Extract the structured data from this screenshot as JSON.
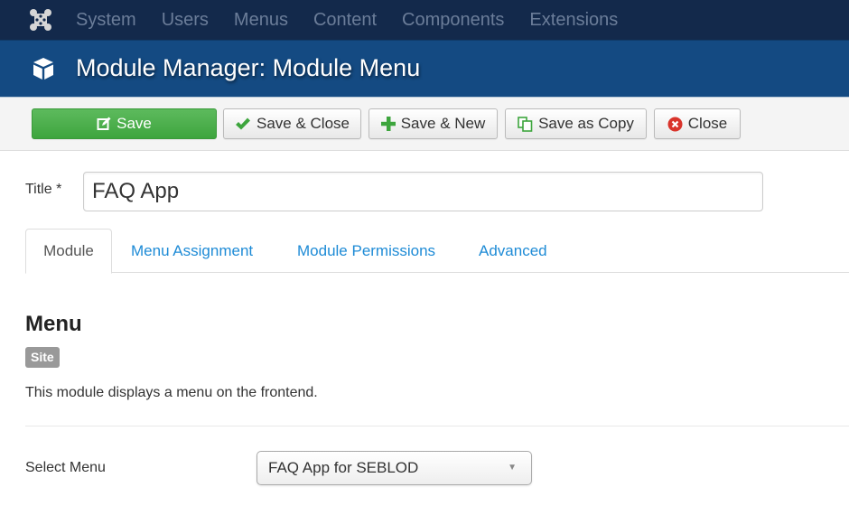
{
  "navbar": {
    "logo_icon": "joomla-logo-icon",
    "items": [
      "System",
      "Users",
      "Menus",
      "Content",
      "Components",
      "Extensions"
    ]
  },
  "header": {
    "icon": "cube-icon",
    "title": "Module Manager: Module Menu"
  },
  "toolbar": {
    "buttons": [
      {
        "label": "Save",
        "icon": "edit-icon",
        "style": "success"
      },
      {
        "label": "Save & Close",
        "icon": "check-icon"
      },
      {
        "label": "Save & New",
        "icon": "plus-icon"
      },
      {
        "label": "Save as Copy",
        "icon": "copy-icon"
      },
      {
        "label": "Close",
        "icon": "cancel-circle-icon"
      }
    ]
  },
  "form": {
    "title_label": "Title *",
    "title_value": "FAQ App"
  },
  "tabs": [
    {
      "label": "Module",
      "active": true
    },
    {
      "label": "Menu Assignment",
      "active": false
    },
    {
      "label": "Module Permissions",
      "active": false
    },
    {
      "label": "Advanced",
      "active": false
    }
  ],
  "content": {
    "section_title": "Menu",
    "badge": "Site",
    "description": "This module displays a menu on the frontend.",
    "select_menu_label": "Select Menu",
    "select_menu_value": "FAQ App for SEBLOD"
  },
  "colors": {
    "navbar_bg": "#13294b",
    "header_bg": "#144a82",
    "success_green": "#46a546",
    "link_blue": "#1e8bd6",
    "badge_gray": "#999999",
    "close_red": "#d9342b"
  }
}
